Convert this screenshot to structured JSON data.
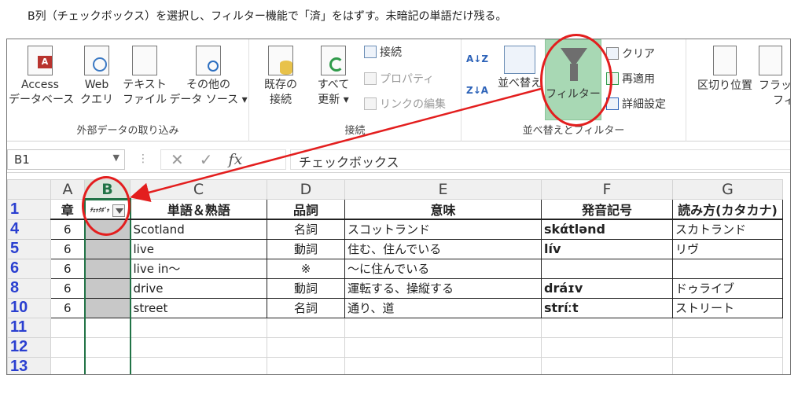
{
  "caption": "B列（チェックボックス）を選択し、フィルター機能で「済」をはずす。未暗記の単語だけ残る。",
  "ribbon": {
    "external_data": {
      "label": "外部データの取り込み",
      "access": [
        "Access",
        "データベース"
      ],
      "web": [
        "Web",
        "クエリ"
      ],
      "text": [
        "テキスト",
        "ファイル"
      ],
      "other": [
        "その他の",
        "データ ソース ▾"
      ]
    },
    "connections": {
      "label": "接続",
      "existing": [
        "既存の",
        "接続"
      ],
      "refresh": [
        "すべて",
        "更新 ▾"
      ],
      "connections_btn": "接続",
      "properties": "プロパティ",
      "edit_links": "リンクの編集"
    },
    "sort_filter": {
      "label": "並べ替えとフィルター",
      "sort": "並べ替え",
      "filter": "フィルター",
      "clear": "クリア",
      "reapply": "再適用",
      "advanced": "詳細設定"
    },
    "data_tools": {
      "text_to_columns": "区切り位置",
      "flash": "フラッシ",
      "flash2": "フィル"
    }
  },
  "formula_bar": {
    "name_box": "B1",
    "content": "チェックボックス"
  },
  "columns": [
    "A",
    "B",
    "C",
    "D",
    "E",
    "F",
    "G"
  ],
  "header_row": {
    "row": "1",
    "cells": [
      "章",
      "ﾁｪｯｸﾎﾞｯ",
      "単語＆熟語",
      "品詞",
      "意味",
      "発音記号",
      "読み方(カタカナ)"
    ]
  },
  "rows": [
    {
      "num": "4",
      "chapter": "6",
      "word": "Scotland",
      "pos": "名詞",
      "meaning": "スコットランド",
      "pron": "skάtlənd",
      "kana": "スカトランド"
    },
    {
      "num": "5",
      "chapter": "6",
      "word": "live",
      "pos": "動詞",
      "meaning": "住む、住んでいる",
      "pron": "lív",
      "kana": "リヴ"
    },
    {
      "num": "6",
      "chapter": "6",
      "word": "live in〜",
      "pos": "※",
      "meaning": "〜に住んでいる",
      "pron": "",
      "kana": ""
    },
    {
      "num": "8",
      "chapter": "6",
      "word": "drive",
      "pos": "動詞",
      "meaning": "運転する、操縦する",
      "pron": "dráɪv",
      "kana": "ドゥライブ"
    },
    {
      "num": "10",
      "chapter": "6",
      "word": "street",
      "pos": "名詞",
      "meaning": "通り、道",
      "pron": "stríːt",
      "kana": "ストリート"
    }
  ],
  "empty_rows": [
    "11",
    "12",
    "13"
  ],
  "colors": {
    "accent": "#217346",
    "annotation": "#e31e1e",
    "filter_active": "#a8d8b4",
    "row_number": "#2a3fd0"
  }
}
